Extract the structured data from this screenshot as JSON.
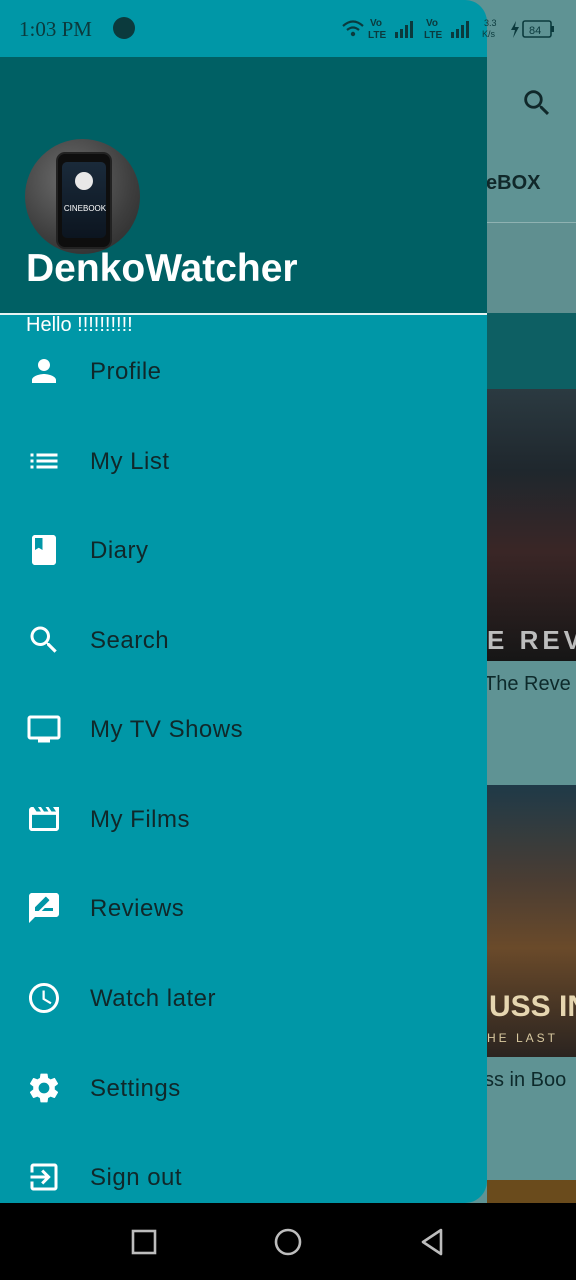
{
  "status_bar": {
    "time": "1:03 PM",
    "net_speed": "3.3\nK/s",
    "net_value": "3.3",
    "net_unit": "K/s",
    "lte_label_1": "Vo\nLTE",
    "lte_label_2": "Vo\nLTE",
    "battery": "84"
  },
  "background_app": {
    "tab_label": "eBOX",
    "poster_1_text": "E REVE",
    "item_1_title": "The Reve",
    "poster_2_text": "USS IN B",
    "poster_2_subtext": "HE LAST",
    "item_2_title": "ss in Boo"
  },
  "drawer": {
    "username": "DenkoWatcher",
    "greeting": "Hello !!!!!!!!!!",
    "avatar_logo_text": "CINEBOOK",
    "menu": [
      {
        "label": "Profile",
        "icon": "person-icon"
      },
      {
        "label": "My List",
        "icon": "list-icon"
      },
      {
        "label": "Diary",
        "icon": "book-icon"
      },
      {
        "label": "Search",
        "icon": "search-icon"
      },
      {
        "label": "My TV Shows",
        "icon": "tv-icon"
      },
      {
        "label": "My Films",
        "icon": "movie-icon"
      },
      {
        "label": "Reviews",
        "icon": "rate-review-icon"
      },
      {
        "label": "Watch later",
        "icon": "clock-icon"
      },
      {
        "label": "Settings",
        "icon": "gear-icon"
      },
      {
        "label": "Sign out",
        "icon": "sign-out-icon"
      }
    ]
  },
  "colors": {
    "drawer_bg": "#0097a7",
    "header_bg": "#006064",
    "text_dark": "#10282a"
  }
}
